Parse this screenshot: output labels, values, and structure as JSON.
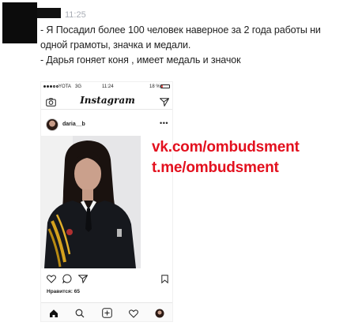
{
  "message": {
    "time": "11:25",
    "lines": [
      "- Я Посадил более 100 человек наверное за 2 года работы ни",
      "одной грамоты, значка и медали.",
      "- Дарья гоняет коня , имеет медаль и значок"
    ]
  },
  "screenshot": {
    "status": {
      "carrier": "YOTA",
      "network": "3G",
      "time": "11:24",
      "battery_text": "18 %",
      "battery_level": 0.18
    },
    "app_title": "Instagram",
    "post": {
      "username": "daria__b",
      "likes": "Нравится: 65"
    }
  },
  "watermark": {
    "vk": "vk.com/ombudsment",
    "tg": "t.me/ombudsment",
    "color": "#e3101e"
  },
  "icons": {
    "camera": "camera-icon",
    "send": "send-icon",
    "more": "more-icon",
    "like": "heart-icon",
    "comment": "comment-icon",
    "share": "share-icon",
    "bookmark": "bookmark-icon",
    "home": "home-icon",
    "search": "search-icon",
    "add": "add-post-icon",
    "activity": "heart-icon",
    "profile": "profile-icon"
  }
}
